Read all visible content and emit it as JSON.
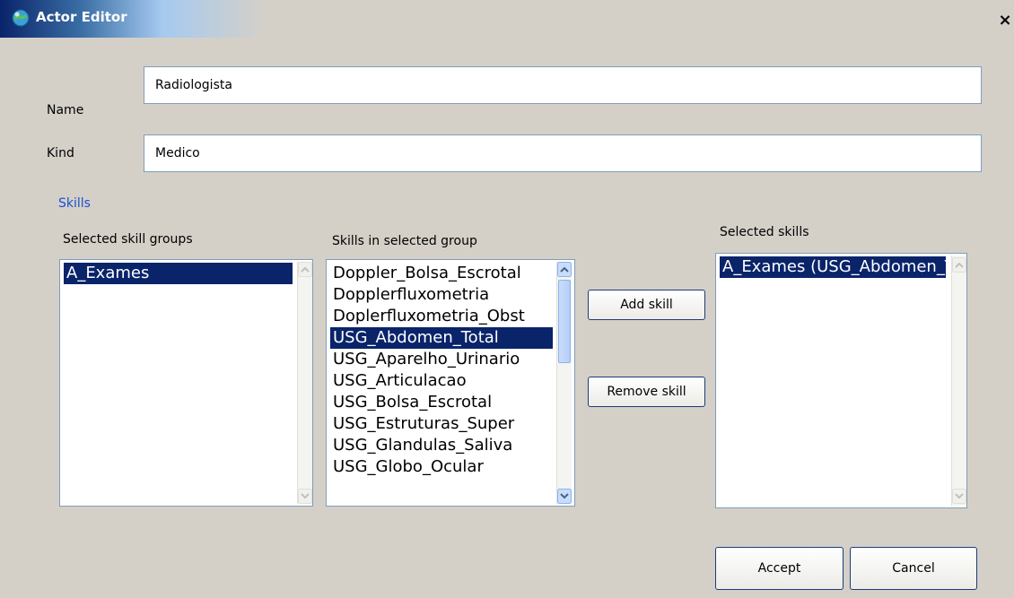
{
  "window": {
    "title": "Actor Editor",
    "close_label": "×"
  },
  "form": {
    "name_label": "Name",
    "name_value": "Radiologista",
    "kind_label": "Kind",
    "kind_value": "Medico"
  },
  "skills": {
    "section_label": "Skills",
    "groups_header": "Selected skill groups",
    "groups": [
      "A_Exames"
    ],
    "groups_selected_index": 0,
    "group_skills_header": "Skills in selected group",
    "group_skills": [
      "Doppler_Bolsa_Escrotal",
      "Dopplerfluxometria",
      "Doplerfluxometria_Obst",
      "USG_Abdomen_Total",
      "USG_Aparelho_Urinario",
      "USG_Articulacao",
      "USG_Bolsa_Escrotal",
      "USG_Estruturas_Super",
      "USG_Glandulas_Saliva",
      "USG_Globo_Ocular"
    ],
    "group_skills_selected_index": 3,
    "selected_header": "Selected skills",
    "selected": [
      "A_Exames (USG_Abdomen_Total)"
    ],
    "selected_index": 0,
    "add_label": "Add skill",
    "remove_label": "Remove skill"
  },
  "actions": {
    "accept_label": "Accept",
    "cancel_label": "Cancel"
  }
}
